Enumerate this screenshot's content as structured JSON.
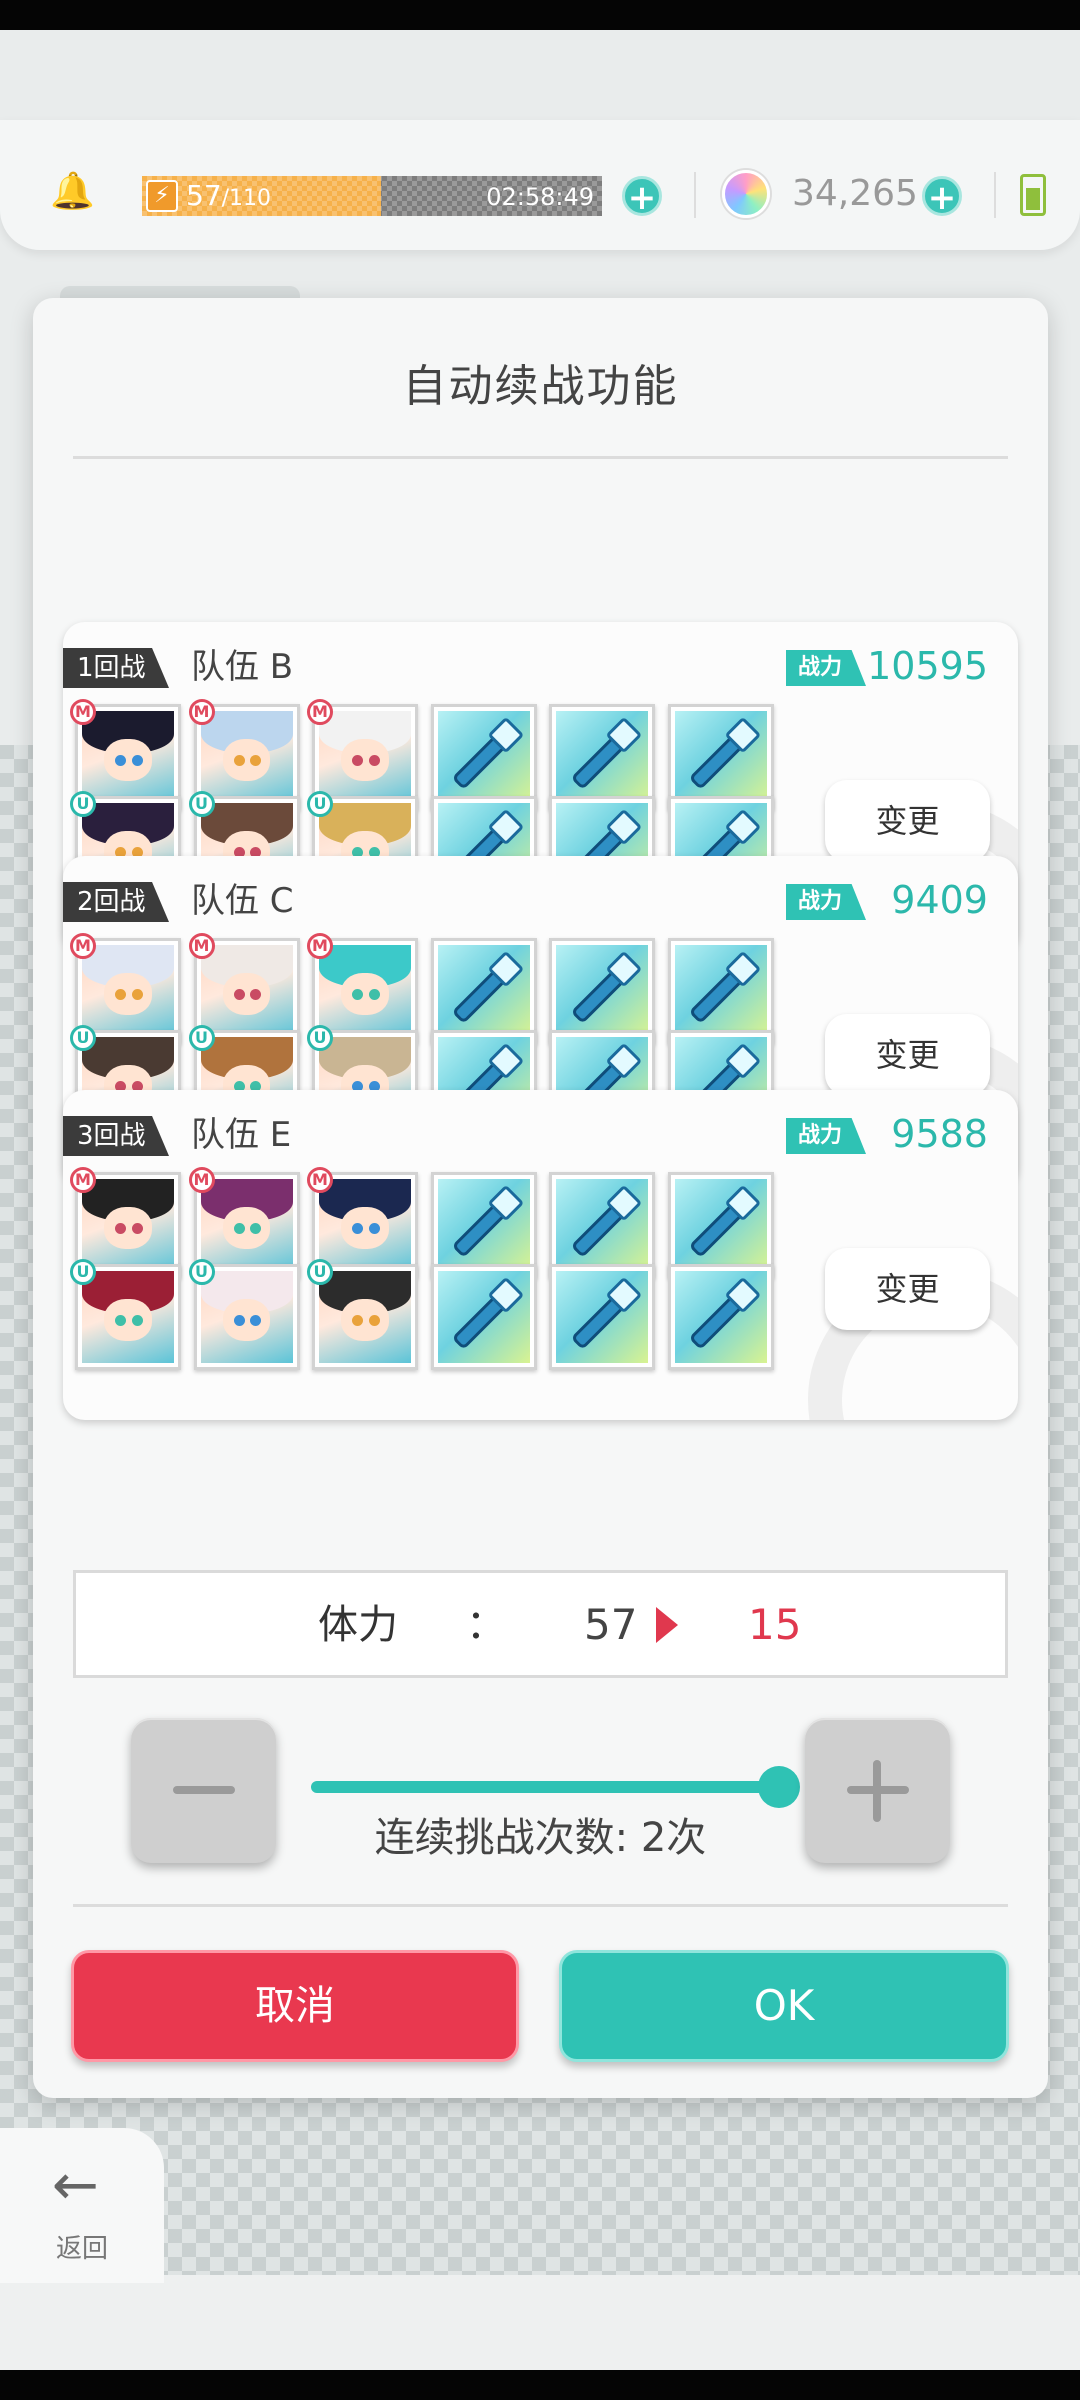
{
  "status_bar": {
    "stamina_current": "57",
    "stamina_max": "/110",
    "stamina_fraction": 0.52,
    "timer": "02:58:49",
    "gems": "34,265",
    "icons": [
      "bell-icon",
      "bolt-icon",
      "plus-icon",
      "gem-icon",
      "battery-icon"
    ]
  },
  "modal": {
    "title": "自动续战功能",
    "power_label": "战力",
    "change_label": "变更",
    "teams": [
      {
        "round": "1回战",
        "name": "队伍 B",
        "power": "10595"
      },
      {
        "round": "2回战",
        "name": "队伍 C",
        "power": "9409"
      },
      {
        "round": "3回战",
        "name": "队伍 E",
        "power": "9588"
      }
    ],
    "stamina": {
      "label": "体力",
      "colon": "：",
      "from": "57",
      "to": "15"
    },
    "count_text": "连续挑战次数: 2次",
    "slider_fraction": 1.0,
    "cancel_label": "取消",
    "ok_label": "OK"
  },
  "back": {
    "label": "返回"
  },
  "colors": {
    "accent": "#2fc2b4",
    "danger": "#e9384f",
    "stamina": "#f6b14a"
  }
}
